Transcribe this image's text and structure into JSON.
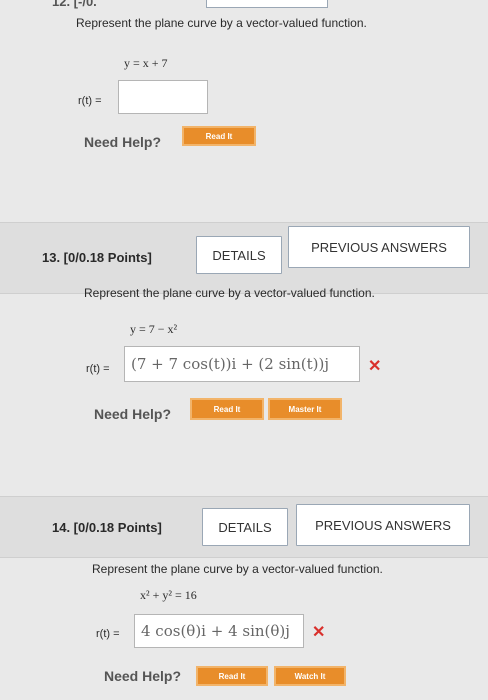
{
  "top": {
    "fragment": "12. [-/0."
  },
  "q12": {
    "prompt": "Represent the plane curve by a vector-valued function.",
    "equation": "y = x + 7",
    "r_label": "r(t) =",
    "answer": "",
    "need_help": "Need Help?",
    "read_it": "Read It"
  },
  "q13": {
    "number": "13. [0/0.18 Points]",
    "details": "DETAILS",
    "previous": "PREVIOUS ANSWERS",
    "prompt": "Represent the plane curve by a vector-valued function.",
    "equation": "y = 7 − x²",
    "r_label": "r(t) =",
    "answer": "(7 + 7 cos(t))i + (2 sin(t))j",
    "mark": "✕",
    "need_help": "Need Help?",
    "read_it": "Read It",
    "master_it": "Master It"
  },
  "q14": {
    "number": "14. [0/0.18 Points]",
    "details": "DETAILS",
    "previous": "PREVIOUS ANSWERS",
    "prompt": "Represent the plane curve by a vector-valued function.",
    "equation": "x² + y² = 16",
    "r_label": "r(t) =",
    "answer": "4 cos(θ)i + 4 sin(θ)j",
    "mark": "✕",
    "need_help": "Need Help?",
    "read_it": "Read It",
    "watch_it": "Watch It"
  }
}
